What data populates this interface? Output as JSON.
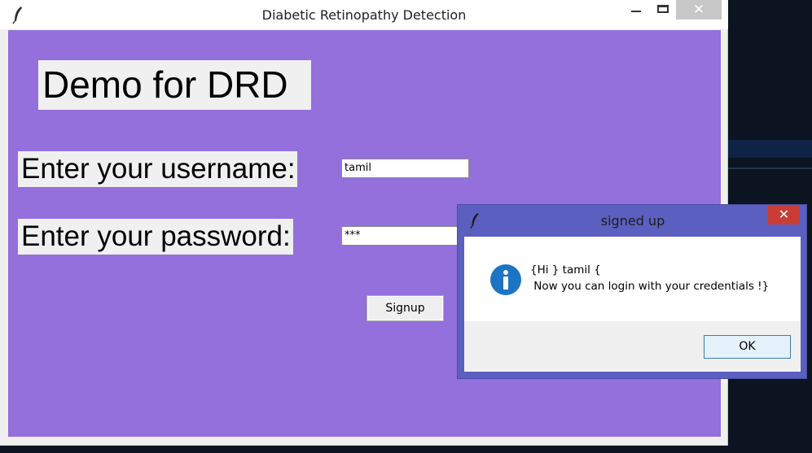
{
  "main_window": {
    "title": "Diabetic Retinopathy Detection",
    "close_glyph": "✕",
    "heading": "Demo for DRD",
    "username_label": "Enter your username:",
    "username_value": "tamil",
    "password_label": "Enter your password:",
    "password_value": "***",
    "signup_label": "Signup",
    "background_color": "#9370db",
    "icons": [
      "tk-feather-icon",
      "minimize-icon",
      "maximize-icon",
      "close-icon"
    ]
  },
  "dialog": {
    "title": "signed up",
    "close_glyph": "✕",
    "message_line1": "{Hi } tamil {",
    "message_line2": " Now you can login with your credentials !}",
    "ok_label": "OK",
    "icons": [
      "tk-feather-icon",
      "info-icon",
      "close-icon"
    ],
    "close_color": "#c93d35",
    "info_icon_color": "#1c75c4"
  }
}
